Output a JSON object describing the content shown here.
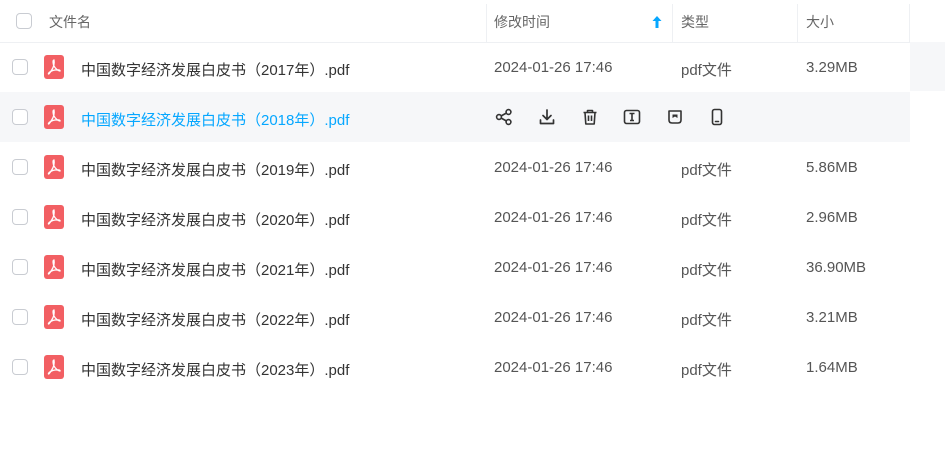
{
  "header": {
    "name": "文件名",
    "time": "修改时间",
    "type": "类型",
    "size": "大小"
  },
  "files": [
    {
      "name": "中国数字经济发展白皮书（2017年）.pdf",
      "time": "2024-01-26 17:46",
      "type": "pdf文件",
      "size": "3.29MB"
    },
    {
      "name": "中国数字经济发展白皮书（2018年）.pdf",
      "time": "",
      "type": "",
      "size": ""
    },
    {
      "name": "中国数字经济发展白皮书（2019年）.pdf",
      "time": "2024-01-26 17:46",
      "type": "pdf文件",
      "size": "5.86MB"
    },
    {
      "name": "中国数字经济发展白皮书（2020年）.pdf",
      "time": "2024-01-26 17:46",
      "type": "pdf文件",
      "size": "2.96MB"
    },
    {
      "name": "中国数字经济发展白皮书（2021年）.pdf",
      "time": "2024-01-26 17:46",
      "type": "pdf文件",
      "size": "36.90MB"
    },
    {
      "name": "中国数字经济发展白皮书（2022年）.pdf",
      "time": "2024-01-26 17:46",
      "type": "pdf文件",
      "size": "3.21MB"
    },
    {
      "name": "中国数字经济发展白皮书（2023年）.pdf",
      "time": "2024-01-26 17:46",
      "type": "pdf文件",
      "size": "1.64MB"
    }
  ],
  "hover_actions": [
    "share-icon",
    "download-icon",
    "delete-icon",
    "text-extract-icon",
    "document-icon",
    "phone-icon"
  ],
  "colors": {
    "accent": "#06a7ff",
    "pdf": "#f25f63",
    "hover_bg": "#f6f7f9"
  }
}
